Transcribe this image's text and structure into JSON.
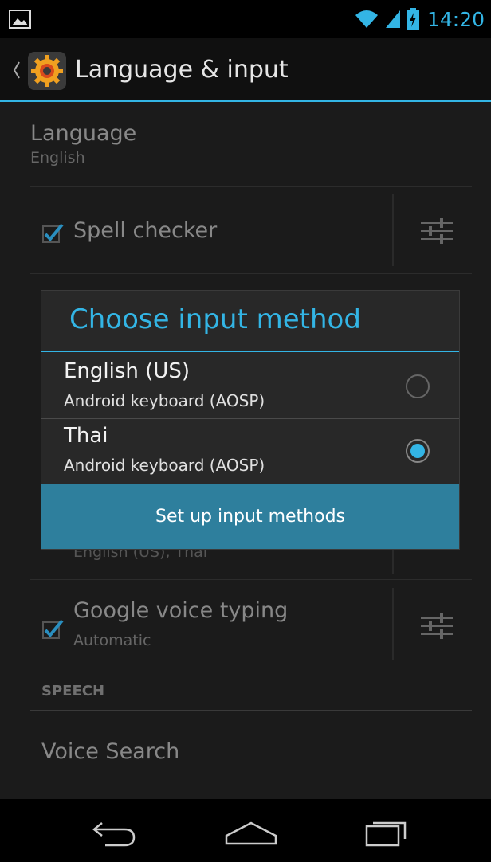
{
  "status_bar": {
    "time": "14:20",
    "icons": [
      "picture-icon",
      "wifi-icon",
      "signal-icon",
      "battery-charging-icon"
    ]
  },
  "action_bar": {
    "title": "Language & input",
    "icon": "settings-gear-icon"
  },
  "list": {
    "language": {
      "title": "Language",
      "subtitle": "English"
    },
    "spell_checker": {
      "title": "Spell checker",
      "checked": true
    },
    "keyboard_default": {
      "subtitle_partial": "English (US), Thai"
    },
    "google_voice_typing": {
      "title": "Google voice typing",
      "subtitle": "Automatic",
      "checked": true
    },
    "speech_header": "SPEECH",
    "voice_search": {
      "title": "Voice Search"
    }
  },
  "dialog": {
    "title": "Choose input method",
    "options": [
      {
        "title": "English (US)",
        "subtitle": "Android keyboard (AOSP)",
        "selected": false
      },
      {
        "title": "Thai",
        "subtitle": "Android keyboard (AOSP)",
        "selected": true
      }
    ],
    "button_label": "Set up input methods"
  },
  "colors": {
    "accent": "#33b5e5",
    "dialog_bg": "#282828",
    "button_bg": "#2e7f9d"
  },
  "nav_bar": {
    "icons": [
      "back-icon",
      "home-icon",
      "recents-icon"
    ]
  }
}
